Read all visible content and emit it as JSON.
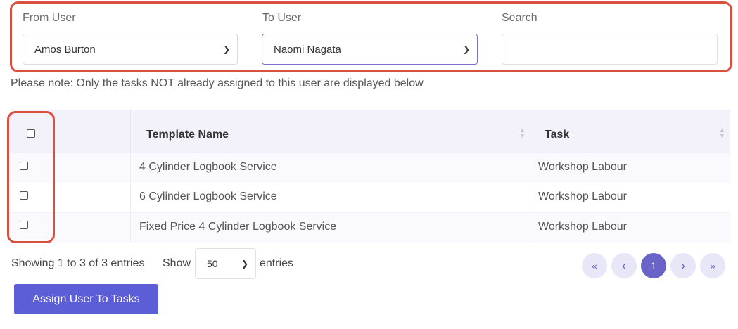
{
  "filters": {
    "from_user": {
      "label": "From User",
      "value": "Amos Burton"
    },
    "to_user": {
      "label": "To User",
      "value": "Naomi Nagata"
    },
    "search": {
      "label": "Search",
      "value": "",
      "placeholder": ""
    }
  },
  "note": "Please note: Only the tasks NOT already assigned to this user are displayed below",
  "table": {
    "columns": [
      "Template Name",
      "Task"
    ],
    "rows": [
      {
        "template": "4 Cylinder Logbook Service",
        "task": "Workshop Labour"
      },
      {
        "template": "6 Cylinder Logbook Service",
        "task": "Workshop Labour"
      },
      {
        "template": "Fixed Price 4 Cylinder Logbook Service",
        "task": "Workshop Labour"
      }
    ]
  },
  "footer": {
    "showing": "Showing 1 to 3 of 3 entries",
    "show_label": "Show",
    "page_size": "50",
    "entries_label": "entries"
  },
  "pagination": {
    "first": "«",
    "prev": "‹",
    "current": "1",
    "next": "›",
    "last": "»"
  },
  "assign_button": "Assign User To Tasks",
  "icons": {
    "dropdown": "chevron-down-icon",
    "sort": "sort-icon"
  },
  "colors": {
    "accent": "#6a64c8",
    "button": "#5b5ed6",
    "highlight": "#d9503f",
    "header_bg": "#f3f2fa"
  }
}
